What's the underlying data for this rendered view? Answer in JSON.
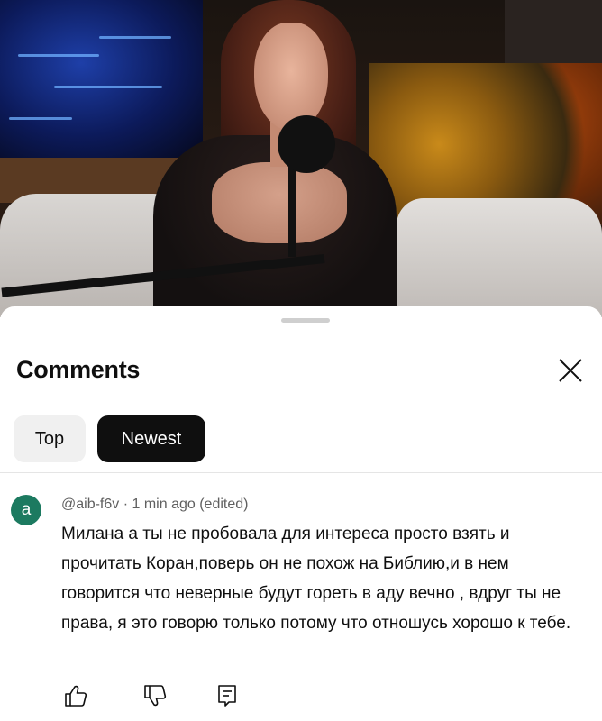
{
  "comments_panel": {
    "title": "Comments",
    "sort_tabs": [
      {
        "label": "Top",
        "selected": false
      },
      {
        "label": "Newest",
        "selected": true
      }
    ]
  },
  "comment": {
    "avatar_letter": "a",
    "author": "@aib-f6v",
    "separator": "·",
    "time": "1 min ago",
    "edited": "(edited)",
    "text": "Милана а ты не пробовала для интереса просто взять и прочитать Коран,поверь он не похож на Библию,и в нем говорится что неверные будут гореть в аду вечно , вдруг ты не права, я это говорю только потому что отношусь хорошо к тебе."
  },
  "icons": {
    "close": "close-icon",
    "like": "thumbs-up-icon",
    "dislike": "thumbs-down-icon",
    "reply": "reply-icon"
  },
  "colors": {
    "active_chip": "#0f0f0f",
    "inactive_chip": "#f0f0f0",
    "avatar": "#1c7a60",
    "meta_text": "#606060"
  }
}
